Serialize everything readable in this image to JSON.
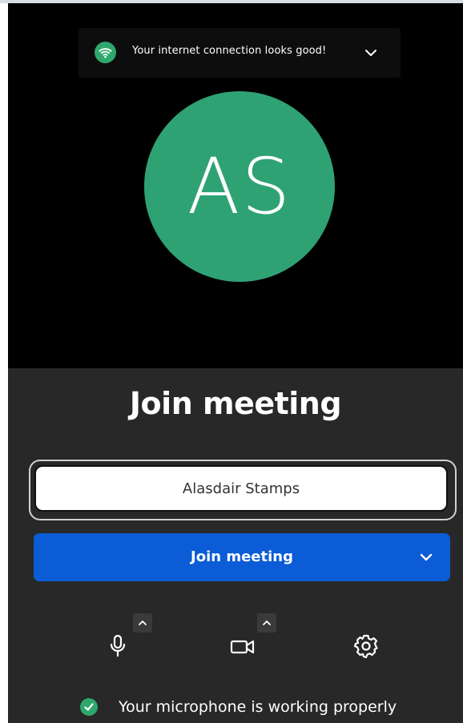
{
  "connection": {
    "message": "Your internet connection looks good!",
    "status_color": "#2ea86d",
    "icon": "wifi-icon"
  },
  "avatar": {
    "initials": "AS",
    "color": "#2fa274"
  },
  "join": {
    "title": "Join meeting",
    "name_value": "Alasdair Stamps",
    "button_label": "Join meeting",
    "button_color": "#0b5cd6"
  },
  "controls": {
    "mic_icon": "microphone-icon",
    "camera_icon": "video-camera-icon",
    "settings_icon": "gear-icon"
  },
  "status": {
    "message": "Your microphone is working properly",
    "icon": "check-circle-icon"
  }
}
